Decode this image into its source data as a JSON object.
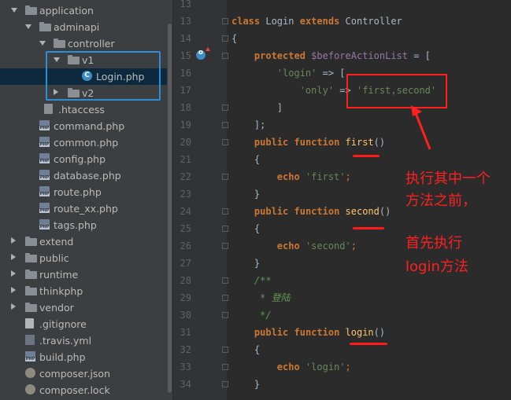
{
  "file_tree": {
    "items": [
      {
        "label": "application",
        "type": "folder",
        "state": "open"
      },
      {
        "label": "adminapi",
        "type": "folder",
        "state": "open"
      },
      {
        "label": "controller",
        "type": "folder",
        "state": "open"
      },
      {
        "label": "v1",
        "type": "folder",
        "state": "open"
      },
      {
        "label": "Login.php",
        "type": "class-file",
        "selected": true
      },
      {
        "label": "v2",
        "type": "folder",
        "state": "closed"
      },
      {
        "label": ".htaccess",
        "type": "htaccess"
      },
      {
        "label": "command.php",
        "type": "php"
      },
      {
        "label": "common.php",
        "type": "php"
      },
      {
        "label": "config.php",
        "type": "php"
      },
      {
        "label": "database.php",
        "type": "php"
      },
      {
        "label": "route.php",
        "type": "php"
      },
      {
        "label": "route_xx.php",
        "type": "php"
      },
      {
        "label": "tags.php",
        "type": "php"
      },
      {
        "label": "extend",
        "type": "folder",
        "state": "closed"
      },
      {
        "label": "public",
        "type": "folder",
        "state": "closed"
      },
      {
        "label": "runtime",
        "type": "folder",
        "state": "closed"
      },
      {
        "label": "thinkphp",
        "type": "folder",
        "state": "closed"
      },
      {
        "label": "vendor",
        "type": "folder",
        "state": "closed"
      },
      {
        "label": ".gitignore",
        "type": "file"
      },
      {
        "label": ".travis.yml",
        "type": "yml"
      },
      {
        "label": "build.php",
        "type": "php"
      },
      {
        "label": "composer.json",
        "type": "composer"
      },
      {
        "label": "composer.lock",
        "type": "composer"
      }
    ]
  },
  "editor": {
    "line_numbers": [
      "13",
      "13",
      "14",
      "15",
      "16",
      "17",
      "18",
      "19",
      "20",
      "21",
      "22",
      "23",
      "24",
      "25",
      "26",
      "27",
      "28",
      "29",
      "30",
      "31",
      "32",
      "33",
      "34"
    ],
    "code": {
      "class_kw": "class",
      "class_name": "Login",
      "extends_kw": "extends",
      "parent": "Controller",
      "brace_open": "{",
      "protected_kw": "protected",
      "prop": "$beforeActionList",
      "assign_bracket": " = [",
      "login_key": "'login'",
      "arrow_bracket": " => [",
      "only_key": "'only'",
      "only_arrow": " => ",
      "only_val": "'first,second'",
      "inner_close": "]",
      "outer_close": "];",
      "public_kw": "public",
      "function_kw": "function",
      "fn_first": "first",
      "fn_second": "second",
      "fn_login": "login",
      "parens": "()",
      "echo_kw": "echo",
      "s_first": "'first'",
      "s_second": "'second'",
      "s_login": "'login'",
      "semicolon": ";",
      "brace_close": "}",
      "doc_open": "/**",
      "doc_text": " * 登陆",
      "doc_close": " */"
    }
  },
  "annotations": {
    "line1": "执行其中一个",
    "line2": "方法之前，",
    "line3": "首先执行",
    "line4": "login方法"
  },
  "colors": {
    "highlight_box_tree": "#2f8dd6",
    "highlight_box_code": "#ff2020",
    "annotation_text": "#ff2020"
  }
}
